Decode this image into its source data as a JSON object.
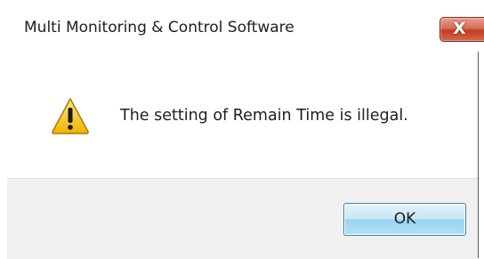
{
  "window": {
    "title": "Multi Monitoring & Control Software",
    "close_label": "X"
  },
  "message": {
    "icon": "warning-icon",
    "text": "The setting of Remain Time is illegal."
  },
  "buttons": {
    "ok_label": "OK"
  },
  "colors": {
    "close_button": "#c94a30",
    "ok_button_border": "#3c7fb1",
    "button_area_bg": "#f0f0f0",
    "warning_fill": "#f5c518"
  }
}
